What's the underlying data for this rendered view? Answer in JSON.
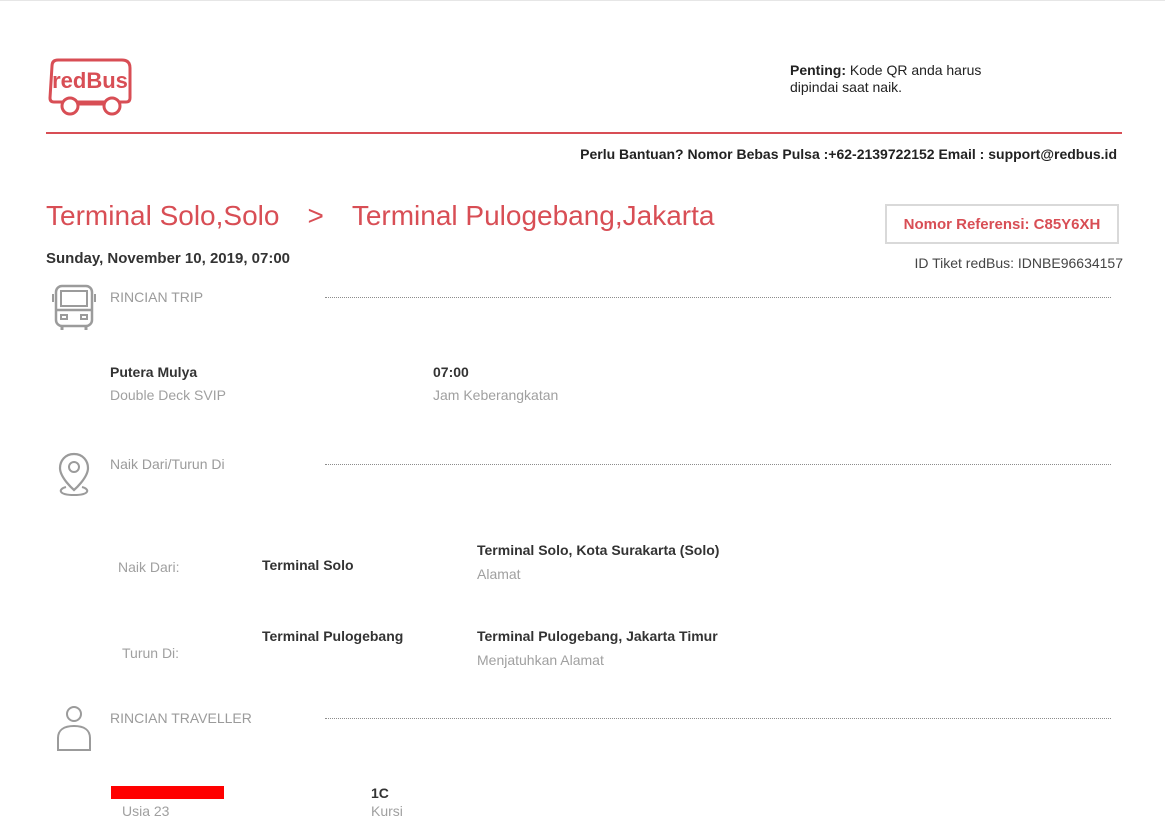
{
  "brand": {
    "logo_text": "redBus",
    "accent": "#d84e55"
  },
  "notice": {
    "label": "Penting:",
    "text": "Kode QR anda harus dipindai saat naik."
  },
  "help_line": "Perlu Bantuan? Nomor Bebas Pulsa :+62-2139722152   Email : support@redbus.id",
  "route": {
    "from": "Terminal Solo,Solo",
    "separator": ">",
    "to": "Terminal Pulogebang,Jakarta"
  },
  "reference": "Nomor Referensi: C85Y6XH",
  "departure_datetime": "Sunday, November 10, 2019, 07:00",
  "ticket_id": "ID Tiket redBus: IDNBE96634157",
  "trip": {
    "section_title": "RINCIAN TRIP",
    "operator": "Putera Mulya",
    "bus_type": "Double Deck SVIP",
    "time": "07:00",
    "time_label": "Jam Keberangkatan"
  },
  "boarding": {
    "section_title": "Naik Dari/Turun Di",
    "rows": [
      {
        "label": "Naik Dari:",
        "point": "Terminal Solo",
        "address": "Terminal Solo, Kota Surakarta (Solo)",
        "address_label": "Alamat"
      },
      {
        "label": "Turun Di:",
        "point": "Terminal Pulogebang",
        "address": "Terminal Pulogebang, Jakarta Timur",
        "address_label": "Menjatuhkan Alamat"
      }
    ]
  },
  "traveller": {
    "section_title": "RINCIAN TRAVELLER",
    "age": "Usia 23",
    "seat": "1C",
    "seat_label": "Kursi"
  }
}
